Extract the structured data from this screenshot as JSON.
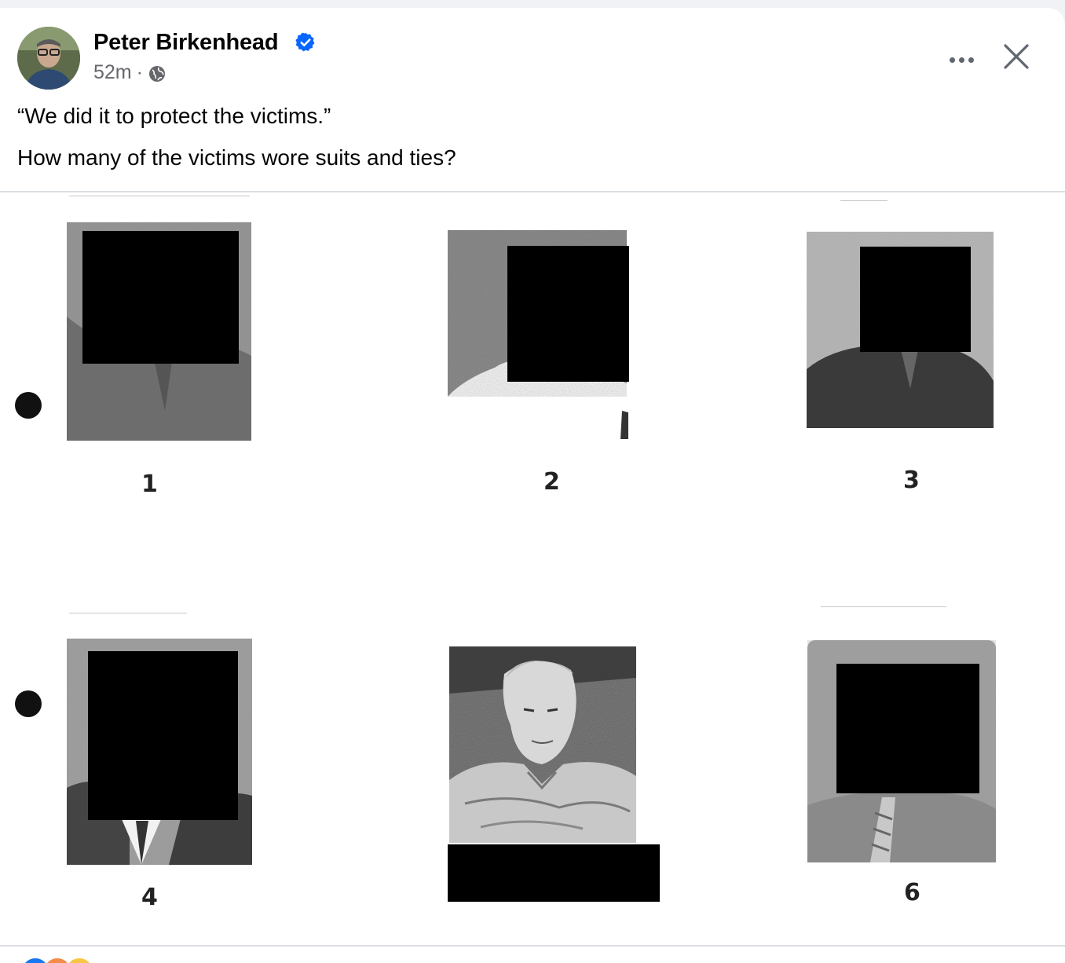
{
  "post": {
    "author": "Peter Birkenhead",
    "verified": true,
    "time": "52m",
    "separator": "·",
    "privacy_icon": "globe-icon",
    "text_line_1": "“We did it to protect the victims.”",
    "text_line_2": "How many of the victims wore suits and ties?"
  },
  "header_actions": {
    "more_icon": "more-horizontal-icon",
    "close_icon": "close-icon"
  },
  "photo_lineup": {
    "labels": [
      "1",
      "2",
      "3",
      "4",
      "6"
    ],
    "redacted_count": 6
  },
  "colors": {
    "accent": "#0866ff",
    "meta_text": "#65676b",
    "page_bg": "#f0f2f5"
  }
}
